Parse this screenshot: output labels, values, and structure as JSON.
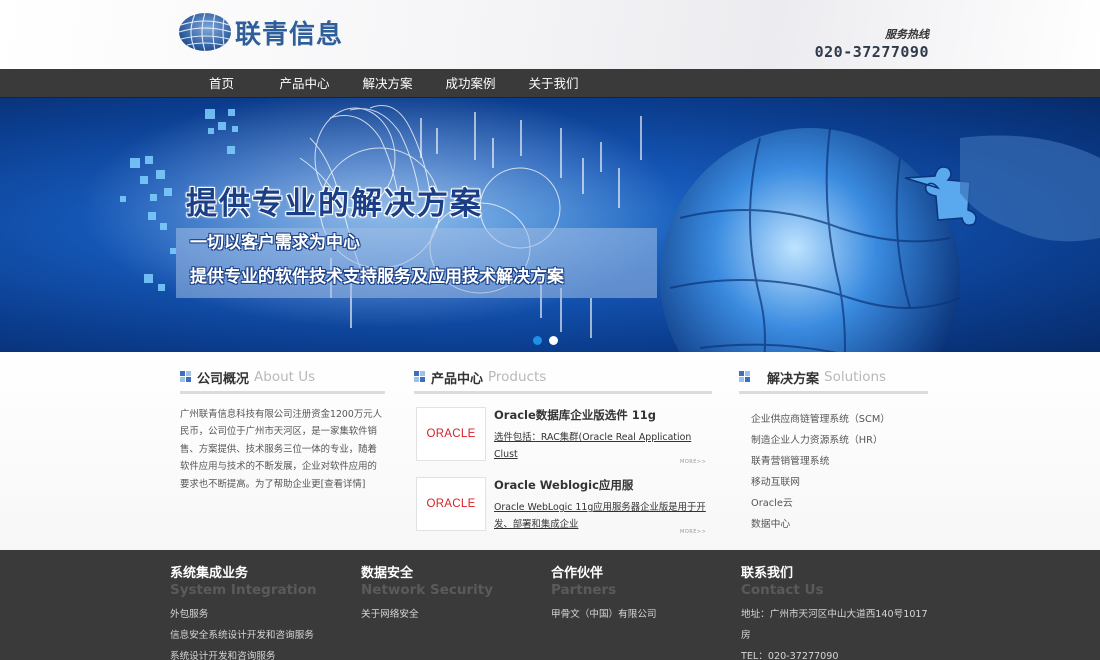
{
  "header": {
    "logo_text": "联青信息",
    "hotline_label": "服务热线",
    "hotline_number": "020-37277090"
  },
  "nav": {
    "items": [
      "首页",
      "产品中心",
      "解决方案",
      "成功案例",
      "关于我们"
    ]
  },
  "banner": {
    "headline": "提供专业的解决方案",
    "subline1": "一切以客户需求为中心",
    "subline2": "提供专业的软件技术支持服务及应用技术解决方案",
    "colors": {
      "primary": "#1558b8",
      "dark": "#072b6a",
      "active_dot": "#1e90e6"
    }
  },
  "about": {
    "title_cn": "公司概况",
    "title_en": "About Us",
    "text": "广州联青信息科技有限公司注册资金1200万元人民币，公司位于广州市天河区，是一家集软件销售、方案提供、技术服务三位一体的专业，随着软件应用与技术的不断发展，企业对软件应用的要求也不断提高。为了帮助企业更[查看详情]"
  },
  "products": {
    "title_cn": "产品中心",
    "title_en": "Products",
    "logo_text": "ORACLE",
    "more_label": "MORE>>",
    "items": [
      {
        "title": "Oracle数据库企业版选件 11g",
        "desc": "选件包括：RAC集群(Oracle Real Application Clust"
      },
      {
        "title": "Oracle Weblogic应用服",
        "desc": "Oracle WebLogic 11g应用服务器企业版是用于开发、部署和集成企业"
      }
    ]
  },
  "solutions": {
    "title_cn": "解决方案",
    "title_en": "Solutions",
    "items": [
      "企业供应商链管理系统（SCM）",
      "制造企业人力资源系统（HR）",
      "联青营销管理系统",
      "移动互联网",
      "Oracle云",
      "数据中心"
    ]
  },
  "footer": {
    "cols": [
      {
        "title_cn": "系统集成业务",
        "title_en": "System Integration",
        "items": [
          "外包服务",
          "信息安全系统设计开发和咨询服务",
          "系统设计开发和咨询服务"
        ]
      },
      {
        "title_cn": "数据安全",
        "title_en": "Network Security",
        "items": [
          "关于网络安全"
        ]
      },
      {
        "title_cn": "合作伙伴",
        "title_en": "Partners",
        "items": [
          "甲骨文（中国）有限公司"
        ]
      },
      {
        "title_cn": "联系我们",
        "title_en": "Contact Us",
        "items": [
          "地址：广州市天河区中山大道西140号1017房",
          "TEL：020-37277090"
        ]
      }
    ]
  }
}
